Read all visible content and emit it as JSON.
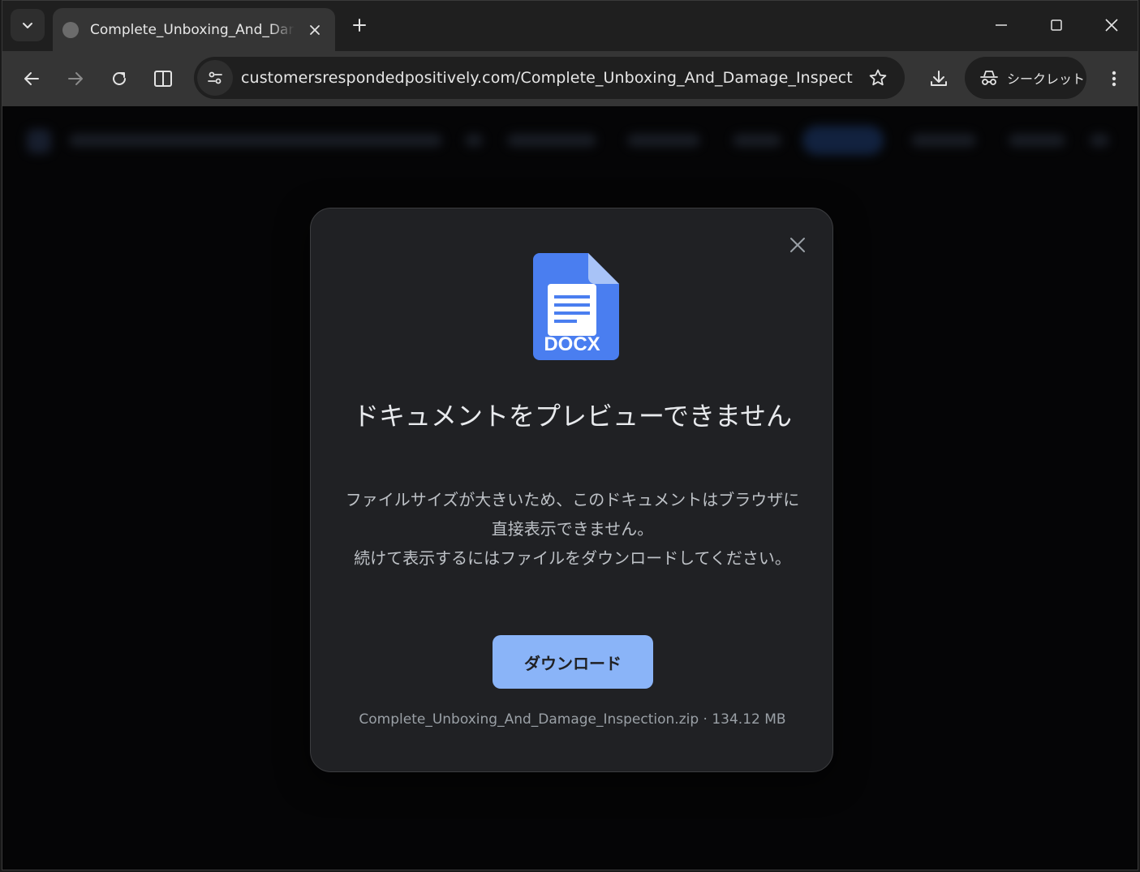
{
  "browser": {
    "tab": {
      "title": "Complete_Unboxing_And_Damage_Inspection"
    },
    "url": "customersrespondedpositively.com/Complete_Unboxing_And_Damage_Inspecti...",
    "incognito_label": "シークレット"
  },
  "modal": {
    "title": "ドキュメントをプレビューできません",
    "description_line1": "ファイルサイズが大きいため、このドキュメントはブラウザに直接表示できません。",
    "description_line2": "続けて表示するにはファイルをダウンロードしてください。",
    "doc_badge": "DOCX",
    "download_label": "ダウンロード",
    "file_info": "Complete_Unboxing_And_Damage_Inspection.zip · 134.12 MB"
  },
  "colors": {
    "accent": "#8ab4f8",
    "doc_blue": "#4a7ef0",
    "modal_bg": "#202124"
  }
}
